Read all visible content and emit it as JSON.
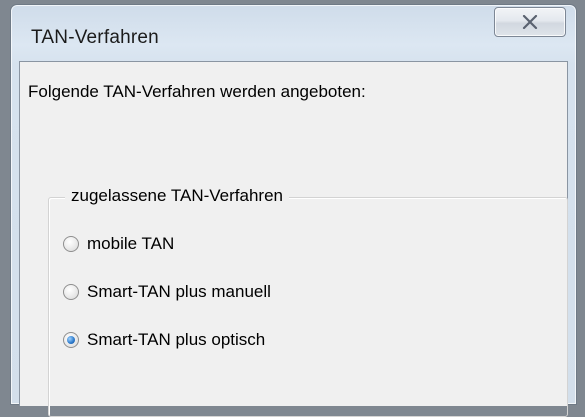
{
  "window": {
    "title": "TAN-Verfahren"
  },
  "dialog": {
    "intro_text": "Folgende TAN-Verfahren werden angeboten:",
    "group_label": "zugelassene TAN-Verfahren",
    "options": [
      {
        "label": "mobile TAN",
        "selected": false
      },
      {
        "label": "Smart-TAN plus manuell",
        "selected": false
      },
      {
        "label": "Smart-TAN plus optisch",
        "selected": true
      }
    ]
  },
  "icons": {
    "close": "close-icon"
  }
}
